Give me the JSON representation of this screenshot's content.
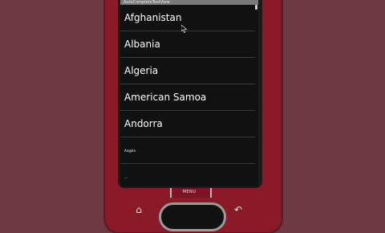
{
  "title_bar": {
    "text": "AutoCompleteTextView"
  },
  "list": {
    "items": [
      {
        "label": "Afghanistan"
      },
      {
        "label": "Albania"
      },
      {
        "label": "Algeria"
      },
      {
        "label": "American Samoa"
      },
      {
        "label": "Andorra"
      },
      {
        "label": "Angola"
      },
      {
        "label": "..."
      }
    ]
  },
  "hardware": {
    "menu_label": "MENU",
    "home_icon": "home-icon",
    "back_icon": "back-icon"
  },
  "colors": {
    "background": "#6e3a42",
    "device_body": "#8a1a28",
    "screen_bg": "#111111",
    "title_bar": "#7a7a7a"
  }
}
